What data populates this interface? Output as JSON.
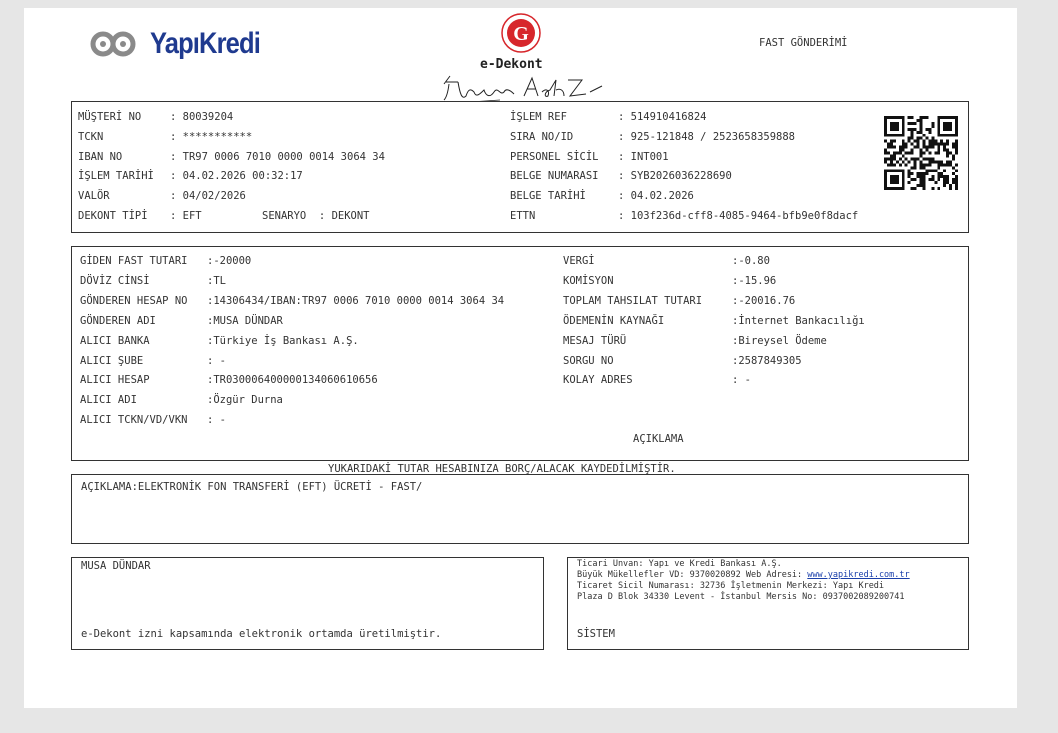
{
  "header": {
    "brand": "YapıKredi",
    "document_title": "e-Dekont",
    "document_type": "FAST GÖNDERİMİ",
    "seal_text": "G"
  },
  "customer": {
    "rows": [
      {
        "label": "MÜŞTERİ NO",
        "value": ": 80039204"
      },
      {
        "label": "TCKN",
        "value": ": ***********"
      },
      {
        "label": "IBAN NO",
        "value": ": TR97 0006 7010 0000 0014 3064 34"
      },
      {
        "label": "İŞLEM TARİHİ",
        "value": ": 04.02.2026 00:32:17"
      },
      {
        "label": "VALÖR",
        "value": ": 04/02/2026"
      },
      {
        "label": "DEKONT TİPİ",
        "value": ": EFT"
      }
    ],
    "scenario_label": "SENARYO",
    "scenario_value": ": DEKONT",
    "ref_rows": [
      {
        "label": "İŞLEM REF",
        "value": ": 514910416824"
      },
      {
        "label": "SIRA NO/ID",
        "value": ": 925-121848 / 2523658359888"
      },
      {
        "label": "PERSONEL SİCİL",
        "value": ": INT001"
      },
      {
        "label": "BELGE NUMARASI",
        "value": ": SYB2026036228690"
      },
      {
        "label": "BELGE TARİHİ",
        "value": ": 04.02.2026"
      },
      {
        "label": "ETTN",
        "value": ": 103f236d-cff8-4085-9464-bfb9e0f8dacf"
      }
    ]
  },
  "transfer": {
    "left": [
      {
        "label": "GİDEN FAST TUTARI",
        "value": ":-20000"
      },
      {
        "label": "DÖVİZ CİNSİ",
        "value": ":TL"
      },
      {
        "label": "GÖNDEREN HESAP NO",
        "value": ":14306434/IBAN:TR97 0006 7010 0000 0014 3064 34"
      },
      {
        "label": "GÖNDEREN ADI",
        "value": ":MUSA DÜNDAR"
      },
      {
        "label": "ALICI BANKA",
        "value": ":Türkiye İş Bankası A.Ş."
      },
      {
        "label": "ALICI ŞUBE",
        "value": ": -"
      },
      {
        "label": "ALICI HESAP",
        "value": ":TR030006400000134060610656"
      },
      {
        "label": "ALICI ADI",
        "value": ":Özgür Durna"
      },
      {
        "label": "ALICI TCKN/VD/VKN",
        "value": ": -"
      }
    ],
    "right": [
      {
        "label": "VERGİ",
        "value": ":-0.80"
      },
      {
        "label": "KOMİSYON",
        "value": ":-15.96"
      },
      {
        "label": "TOPLAM TAHSILAT TUTARI",
        "value": ":-20016.76"
      },
      {
        "label": "ÖDEMENİN KAYNAĞI",
        "value": ":İnternet Bankacılığı"
      },
      {
        "label": "MESAJ TÜRÜ",
        "value": ":Bireysel Ödeme"
      },
      {
        "label": "SORGU NO",
        "value": ":2587849305"
      },
      {
        "label": "KOLAY ADRES",
        "value": ": -"
      }
    ],
    "aciklama_heading": "AÇIKLAMA"
  },
  "notice": "YUKARIDAKİ TUTAR HESABINIZA BORÇ/ALACAK KAYDEDİLMİŞTİR.",
  "description": "AÇIKLAMA:ELEKTRONİK FON TRANSFERİ (EFT) ÜCRETİ - FAST/",
  "footer": {
    "customer_name": "MUSA DÜNDAR",
    "edekont_note": "e-Dekont izni kapsamında elektronik ortamda üretilmiştir.",
    "bank_line1": "Ticari Unvan: Yapı ve Kredi Bankası A.Ş.",
    "bank_line2_prefix": "Büyük Mükellefler VD: 9370020892 Web Adresi: ",
    "bank_web": "www.yapikredi.com.tr",
    "bank_line3": "Ticaret Sicil Numarası: 32736 İşletmenin Merkezi: Yapı Kredi",
    "bank_line4": "Plaza D Blok 34330 Levent - İstanbul Mersis No: 0937002089200741",
    "system_label": "SİSTEM"
  },
  "colors": {
    "brand_blue": "#1f3a8f",
    "logo_gray": "#8a8a8a",
    "seal_red": "#d7262b",
    "link": "#1a3faa"
  }
}
